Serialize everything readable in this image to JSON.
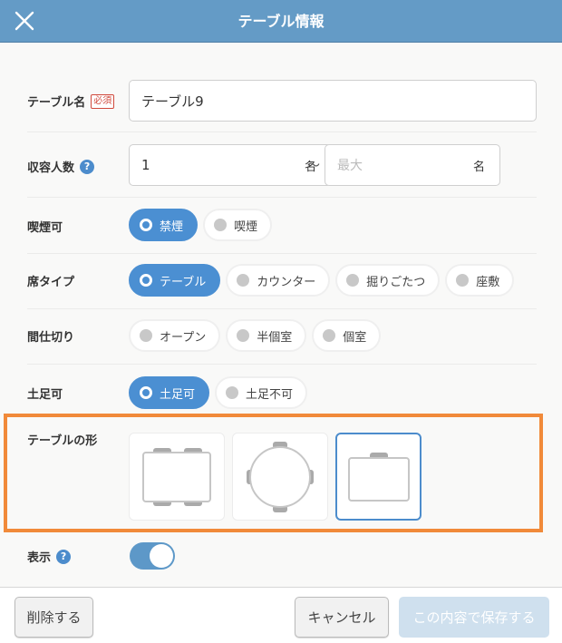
{
  "header": {
    "title": "テーブル情報",
    "close_icon": "close-icon"
  },
  "form": {
    "table_name": {
      "label": "テーブル名",
      "required_badge": "必須",
      "value": "テーブル9"
    },
    "capacity": {
      "label": "収容人数",
      "help": "?",
      "min_value": "1",
      "min_unit": "名",
      "separator": "〜",
      "max_placeholder": "最大",
      "max_unit": "名"
    },
    "smoking": {
      "label": "喫煙可",
      "options": [
        {
          "label": "禁煙",
          "selected": true
        },
        {
          "label": "喫煙",
          "selected": false
        }
      ]
    },
    "seat_type": {
      "label": "席タイプ",
      "options": [
        {
          "label": "テーブル",
          "selected": true
        },
        {
          "label": "カウンター",
          "selected": false
        },
        {
          "label": "掘りごたつ",
          "selected": false
        },
        {
          "label": "座敷",
          "selected": false
        }
      ]
    },
    "partition": {
      "label": "間仕切り",
      "options": [
        {
          "label": "オープン",
          "selected": false
        },
        {
          "label": "半個室",
          "selected": false
        },
        {
          "label": "個室",
          "selected": false
        }
      ]
    },
    "shoes": {
      "label": "土足可",
      "options": [
        {
          "label": "土足可",
          "selected": true
        },
        {
          "label": "土足不可",
          "selected": false
        }
      ]
    },
    "shape": {
      "label": "テーブルの形",
      "options": [
        {
          "name": "square-4-seat-icon",
          "selected": false
        },
        {
          "name": "round-4-seat-icon",
          "selected": false
        },
        {
          "name": "square-1-seat-icon",
          "selected": true
        }
      ]
    },
    "visible": {
      "label": "表示",
      "help": "?",
      "on": true
    }
  },
  "colors": {
    "accent": "#4b8fd2",
    "header": "#649bc6",
    "highlight": "#f18a3a",
    "required": "#d0493c"
  },
  "footer": {
    "delete_label": "削除する",
    "cancel_label": "キャンセル",
    "save_label": "この内容で保存する"
  }
}
